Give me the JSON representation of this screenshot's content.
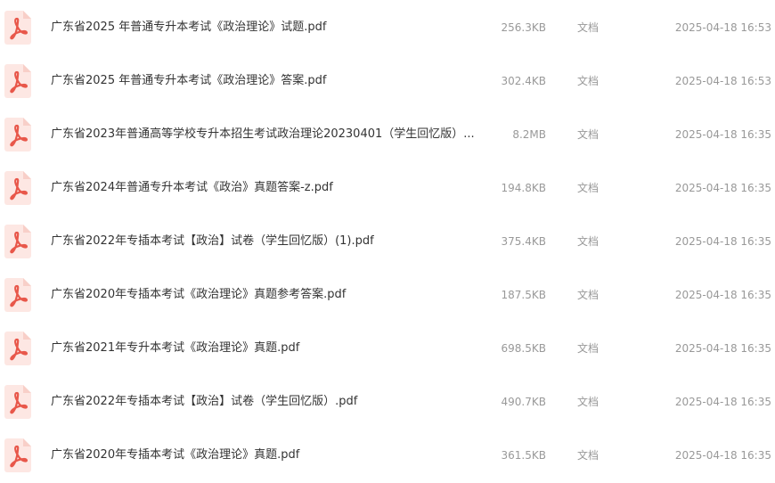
{
  "colors": {
    "pdf_icon_bg": "#fde7e3",
    "pdf_icon_glyph": "#e8574a",
    "name_text": "#333333",
    "meta_text": "#999999"
  },
  "files": [
    {
      "icon": "pdf-icon",
      "name": "广东省2025 年普通专升本考试《政治理论》试题.pdf",
      "size": "256.3KB",
      "type": "文档",
      "date": "2025-04-18 16:53"
    },
    {
      "icon": "pdf-icon",
      "name": "广东省2025 年普通专升本考试《政治理论》答案.pdf",
      "size": "302.4KB",
      "type": "文档",
      "date": "2025-04-18 16:53"
    },
    {
      "icon": "pdf-icon",
      "name": "广东省2023年普通高等学校专升本招生考试政治理论20230401（学生回忆版）...",
      "size": "8.2MB",
      "type": "文档",
      "date": "2025-04-18 16:35"
    },
    {
      "icon": "pdf-icon",
      "name": "广东省2024年普通专升本考试《政治》真题答案-z.pdf",
      "size": "194.8KB",
      "type": "文档",
      "date": "2025-04-18 16:35"
    },
    {
      "icon": "pdf-icon",
      "name": "广东省2022年专插本考试【政治】试卷（学生回忆版）(1).pdf",
      "size": "375.4KB",
      "type": "文档",
      "date": "2025-04-18 16:35"
    },
    {
      "icon": "pdf-icon",
      "name": "广东省2020年专插本考试《政治理论》真题参考答案.pdf",
      "size": "187.5KB",
      "type": "文档",
      "date": "2025-04-18 16:35"
    },
    {
      "icon": "pdf-icon",
      "name": "广东省2021年专升本考试《政治理论》真题.pdf",
      "size": "698.5KB",
      "type": "文档",
      "date": "2025-04-18 16:35"
    },
    {
      "icon": "pdf-icon",
      "name": "广东省2022年专插本考试【政治】试卷（学生回忆版）.pdf",
      "size": "490.7KB",
      "type": "文档",
      "date": "2025-04-18 16:35"
    },
    {
      "icon": "pdf-icon",
      "name": "广东省2020年专插本考试《政治理论》真题.pdf",
      "size": "361.5KB",
      "type": "文档",
      "date": "2025-04-18 16:35"
    }
  ]
}
